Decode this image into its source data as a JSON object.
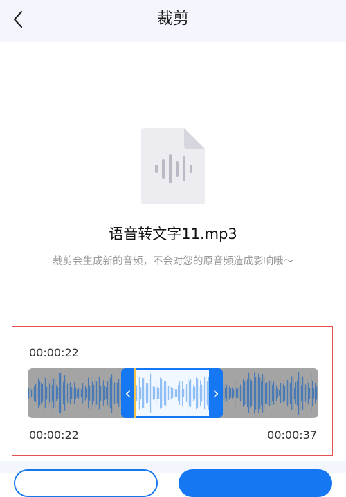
{
  "header": {
    "title": "裁剪"
  },
  "file": {
    "name": "语音转文字11.mp3",
    "hint": "裁剪会生成新的音频，不会对您的原音频造成影响哦～"
  },
  "trim": {
    "current_time": "00:00:22",
    "start_time": "00:00:22",
    "end_time": "00:00:37"
  },
  "icons": {
    "back": "chevron-left-icon",
    "file": "audio-file-icon",
    "handle_left": "chevron-left-icon",
    "handle_right": "chevron-right-icon"
  },
  "colors": {
    "accent": "#1677f2",
    "playhead": "#f3c24a",
    "panel_border": "#e25151",
    "wave_dark": "#4a7ab5",
    "wave_light": "#8fbff5"
  }
}
